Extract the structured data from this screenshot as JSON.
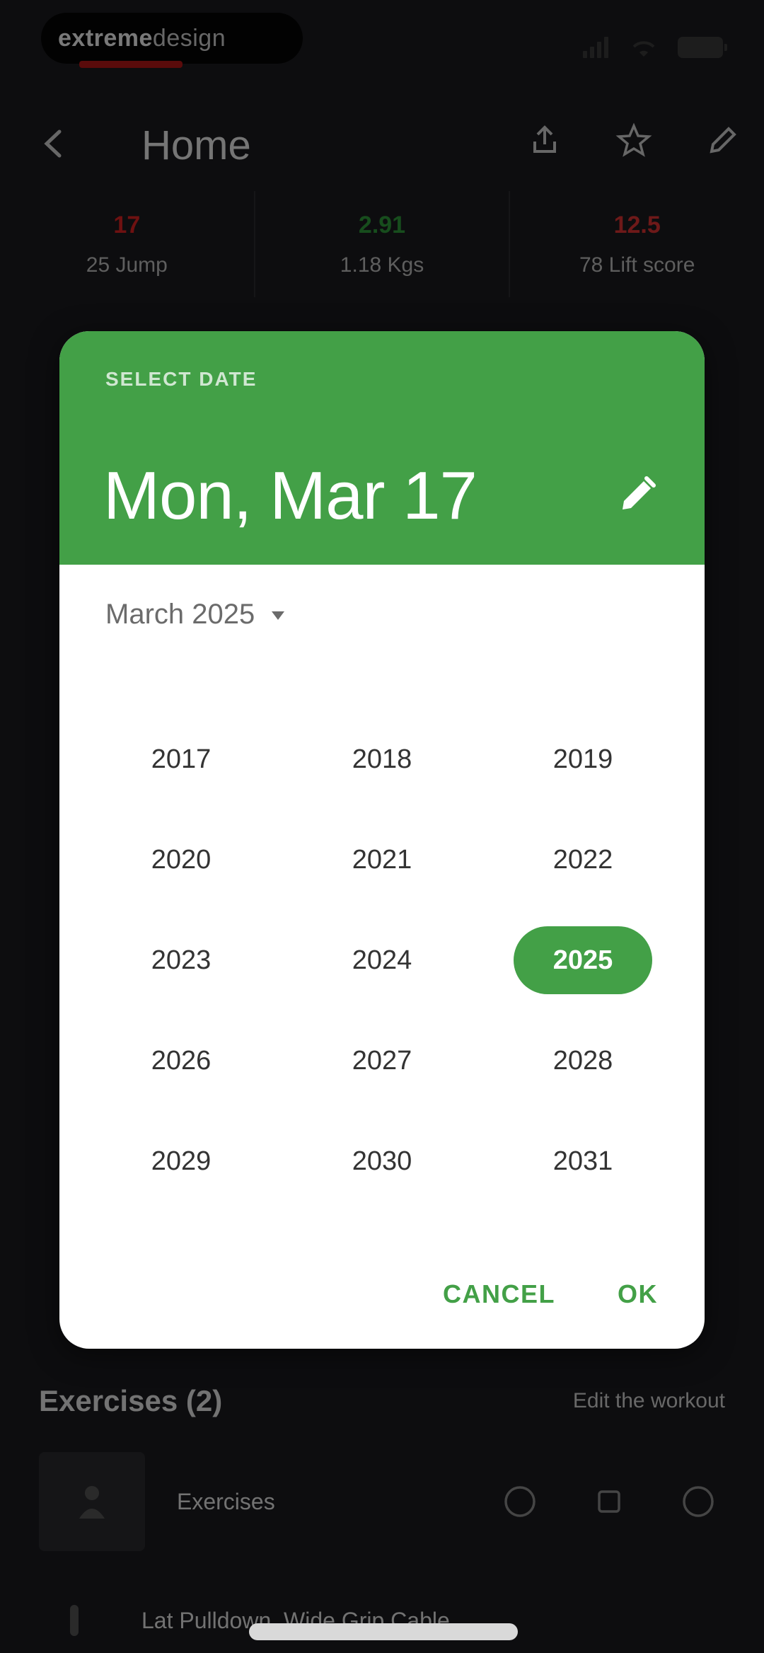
{
  "status_bar": {
    "pill_bold": "extreme",
    "pill_light": "design"
  },
  "app_bar": {
    "title": "Home",
    "icons": [
      "back-arrow-icon",
      "share-icon",
      "star-icon",
      "edit-pencil-icon"
    ]
  },
  "stats": [
    {
      "value": "17",
      "label": "25 Jump"
    },
    {
      "value": "2.91",
      "label": "1.18 Kgs"
    },
    {
      "value": "12.5",
      "label": "78 Lift score"
    }
  ],
  "dialog": {
    "overline": "SELECT DATE",
    "selected_date": "Mon, Mar 17",
    "month_label": "March 2025",
    "years": [
      "2017",
      "2018",
      "2019",
      "2020",
      "2021",
      "2022",
      "2023",
      "2024",
      "2025",
      "2026",
      "2027",
      "2028",
      "2029",
      "2030",
      "2031"
    ],
    "selected_year": "2025",
    "cancel_label": "CANCEL",
    "ok_label": "OK",
    "accent_color": "#43a047"
  },
  "section": {
    "title": "Exercises (2)",
    "link": "Edit the workout"
  },
  "list": [
    {
      "text": "Exercises"
    },
    {
      "text": "Lat Pulldown, Wide Grip Cable"
    }
  ]
}
